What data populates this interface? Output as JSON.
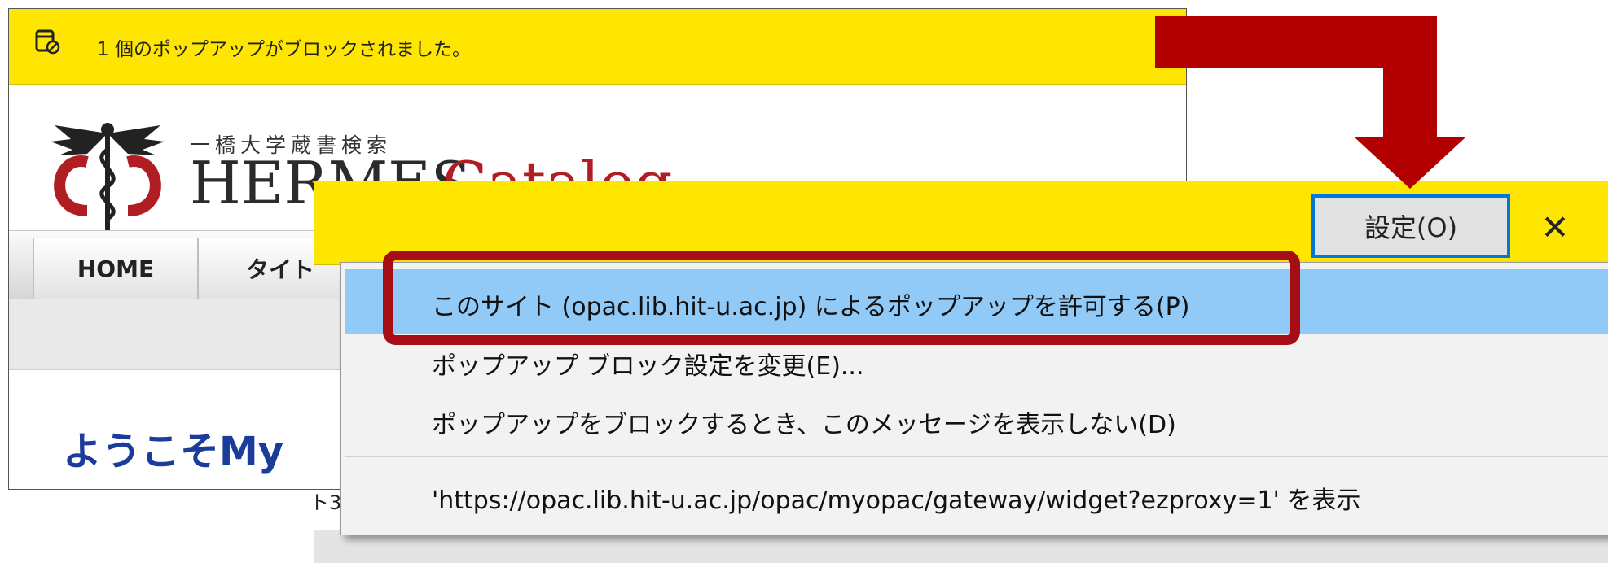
{
  "background_window": {
    "notification_text": "1 個のポップアップがブロックされました。",
    "logo": {
      "subtitle": "一橋大学蔵書検索",
      "title_black": "HERMES",
      "title_red": "Catalog"
    },
    "nav_tabs": [
      "HOME",
      "タイト"
    ],
    "welcome_text": "ようこそMy",
    "partial_text": "ト3"
  },
  "notification_bar": {
    "settings_label": "設定(O)",
    "close_symbol": "✕"
  },
  "popup_menu": {
    "items": [
      "このサイト (opac.lib.hit-u.ac.jp) によるポップアップを許可する(P)",
      "ポップアップ ブロック設定を変更(E)...",
      "ポップアップをブロックするとき、このメッセージを表示しない(D)",
      "'https://opac.lib.hit-u.ac.jp/opac/myopac/gateway/widget?ezproxy=1' を表示"
    ]
  },
  "colors": {
    "notification_yellow": "#ffe600",
    "highlight_blue": "#91c9f7",
    "annotation_red": "#a60d14",
    "focus_blue": "#0078d7",
    "welcome_blue": "#1a3c9a",
    "logo_red": "#b01e23"
  },
  "icons": {
    "notification_icon": "popup-blocked-icon",
    "logo_icon": "caduceus-emblem-icon",
    "close_icon": "close-icon",
    "arrow": "down-arrow-annotation-icon"
  }
}
